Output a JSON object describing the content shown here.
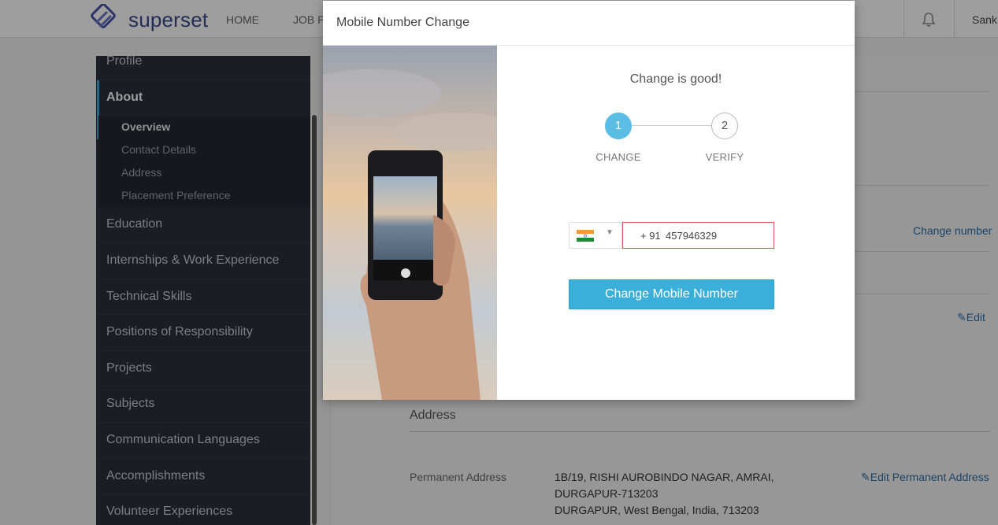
{
  "header": {
    "brand": "superset",
    "nav": [
      "HOME",
      "JOB P"
    ],
    "user": "Sank"
  },
  "sidebar": {
    "profile": "Profile",
    "about": "About",
    "about_sub": [
      "Overview",
      "Contact Details",
      "Address",
      "Placement Preference"
    ],
    "items": [
      "Education",
      "Internships & Work Experience",
      "Technical Skills",
      "Positions of Responsibility",
      "Projects",
      "Subjects",
      "Communication Languages",
      "Accomplishments",
      "Volunteer Experiences"
    ]
  },
  "main": {
    "change_number": "Change number",
    "edit": "Edit",
    "address_heading": "Address",
    "permanent_label": "Permanent Address",
    "permanent_lines": [
      "1B/19, RISHI AUROBINDO NAGAR, AMRAI,",
      "DURGAPUR-713203",
      "DURGAPUR, West Bengal, India, 713203"
    ],
    "edit_permanent": "Edit Permanent Address"
  },
  "modal": {
    "title": "Mobile Number Change",
    "tagline": "Change is good!",
    "steps": [
      {
        "number": "1",
        "label": "CHANGE"
      },
      {
        "number": "2",
        "label": "VERIFY"
      }
    ],
    "country_prefix": "+ 91",
    "phone_value": "457946329",
    "submit_label": "Change Mobile Number"
  },
  "colors": {
    "accent": "#3aafda",
    "error_border": "#d9534f",
    "sidebar_bg": "#2b2f3a",
    "link": "#2e6da4"
  }
}
